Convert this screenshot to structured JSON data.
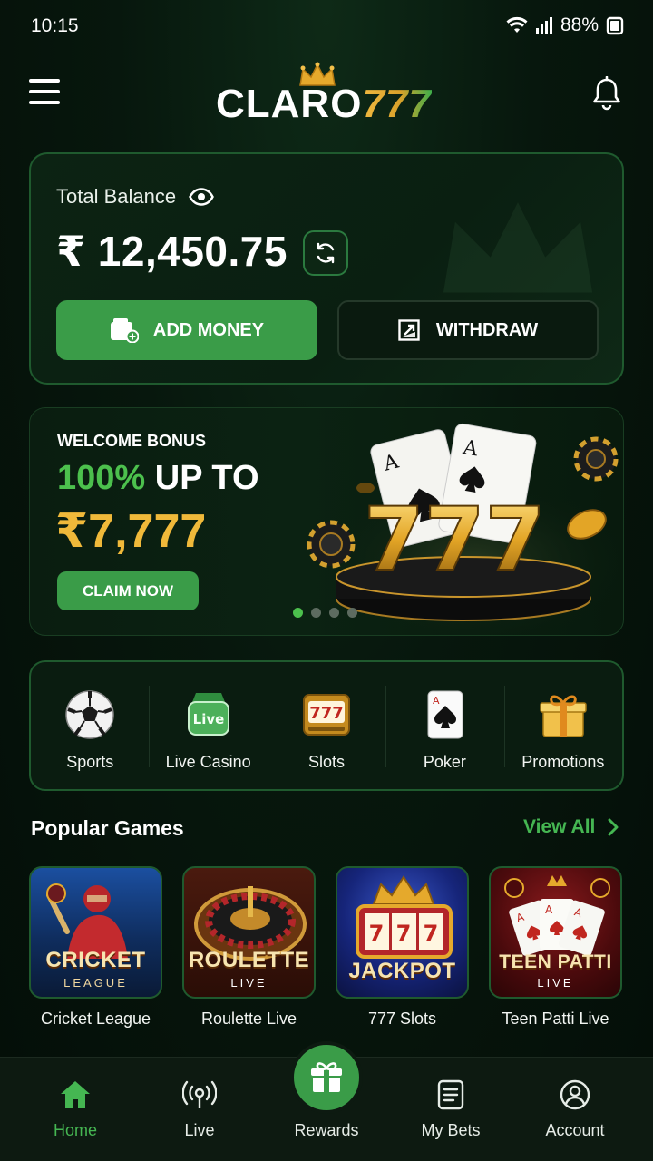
{
  "status_bar": {
    "time": "10:15",
    "battery": "88%"
  },
  "header": {
    "logo_claro": "CLARO",
    "logo_num": "777"
  },
  "balance": {
    "label": "Total Balance",
    "amount": "₹ 12,450.75",
    "add_money_label": "ADD MONEY",
    "withdraw_label": "WITHDRAW"
  },
  "banner": {
    "eyebrow": "WELCOME BONUS",
    "percent": "100%",
    "up_to": "UP TO",
    "amount": "₹7,777",
    "cta": "CLAIM NOW",
    "slide_count": 4,
    "active_slide": 1
  },
  "categories": [
    {
      "label": "Sports",
      "icon": "football-icon"
    },
    {
      "label": "Live Casino",
      "icon": "live-casino-icon"
    },
    {
      "label": "Slots",
      "icon": "slot-machine-icon"
    },
    {
      "label": "Poker",
      "icon": "playing-card-icon"
    },
    {
      "label": "Promotions",
      "icon": "gift-icon"
    }
  ],
  "popular_games": {
    "title": "Popular Games",
    "view_all": "View All",
    "items": [
      {
        "label": "Cricket League",
        "thumb_title": "CRICKET",
        "thumb_sub": "LEAGUE"
      },
      {
        "label": "Roulette Live",
        "thumb_title": "ROULETTE",
        "thumb_sub": "LIVE"
      },
      {
        "label": "777 Slots",
        "thumb_title": "JACKPOT",
        "thumb_sub": ""
      },
      {
        "label": "Teen Patti Live",
        "thumb_title": "TEEN PATTI",
        "thumb_sub": "LIVE"
      }
    ]
  },
  "bottom_nav": {
    "items": [
      {
        "label": "Home",
        "icon": "home-icon",
        "active": true
      },
      {
        "label": "Live",
        "icon": "broadcast-icon"
      },
      {
        "label": "Rewards",
        "icon": "gift-icon"
      },
      {
        "label": "My Bets",
        "icon": "receipt-icon"
      },
      {
        "label": "Account",
        "icon": "user-icon"
      }
    ]
  },
  "colors": {
    "accent": "#3a9c48",
    "gold": "#f0b93a",
    "background": "#06140b"
  }
}
